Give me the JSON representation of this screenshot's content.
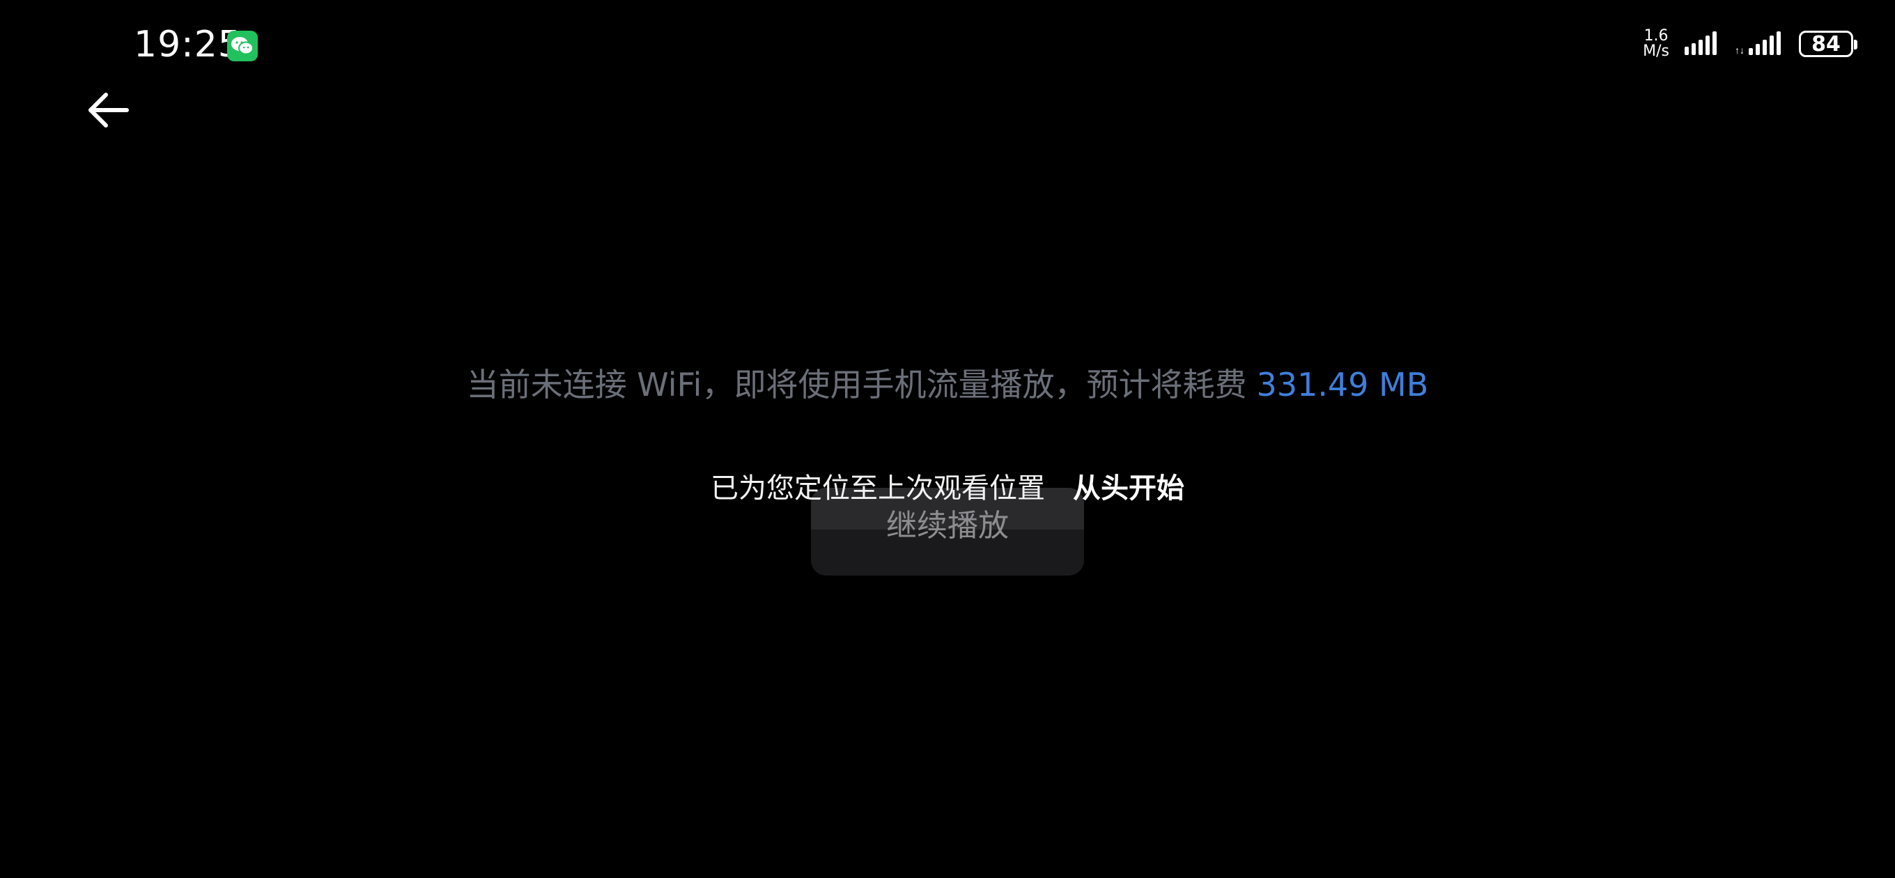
{
  "status_bar": {
    "time": "19:25",
    "app_icon": "wechat-icon",
    "net_speed_value": "1.6",
    "net_speed_unit": "M/s",
    "signal_icons": [
      "signal-icon",
      "signal-icon"
    ],
    "battery_level": "84"
  },
  "nav": {
    "back_icon": "back-arrow-icon"
  },
  "player": {
    "data_warning_text": "当前未连接 WiFi，即将使用手机流量播放，预计将耗费",
    "data_size": "331.49 MB",
    "resume_button_label": "继续播放"
  },
  "toast": {
    "message": "已为您定位至上次观看位置",
    "action_label": "从头开始"
  },
  "colors": {
    "background": "#000000",
    "accent": "#3f7fdc",
    "muted_text": "#6b6f79",
    "wechat_green": "#22c15e"
  }
}
